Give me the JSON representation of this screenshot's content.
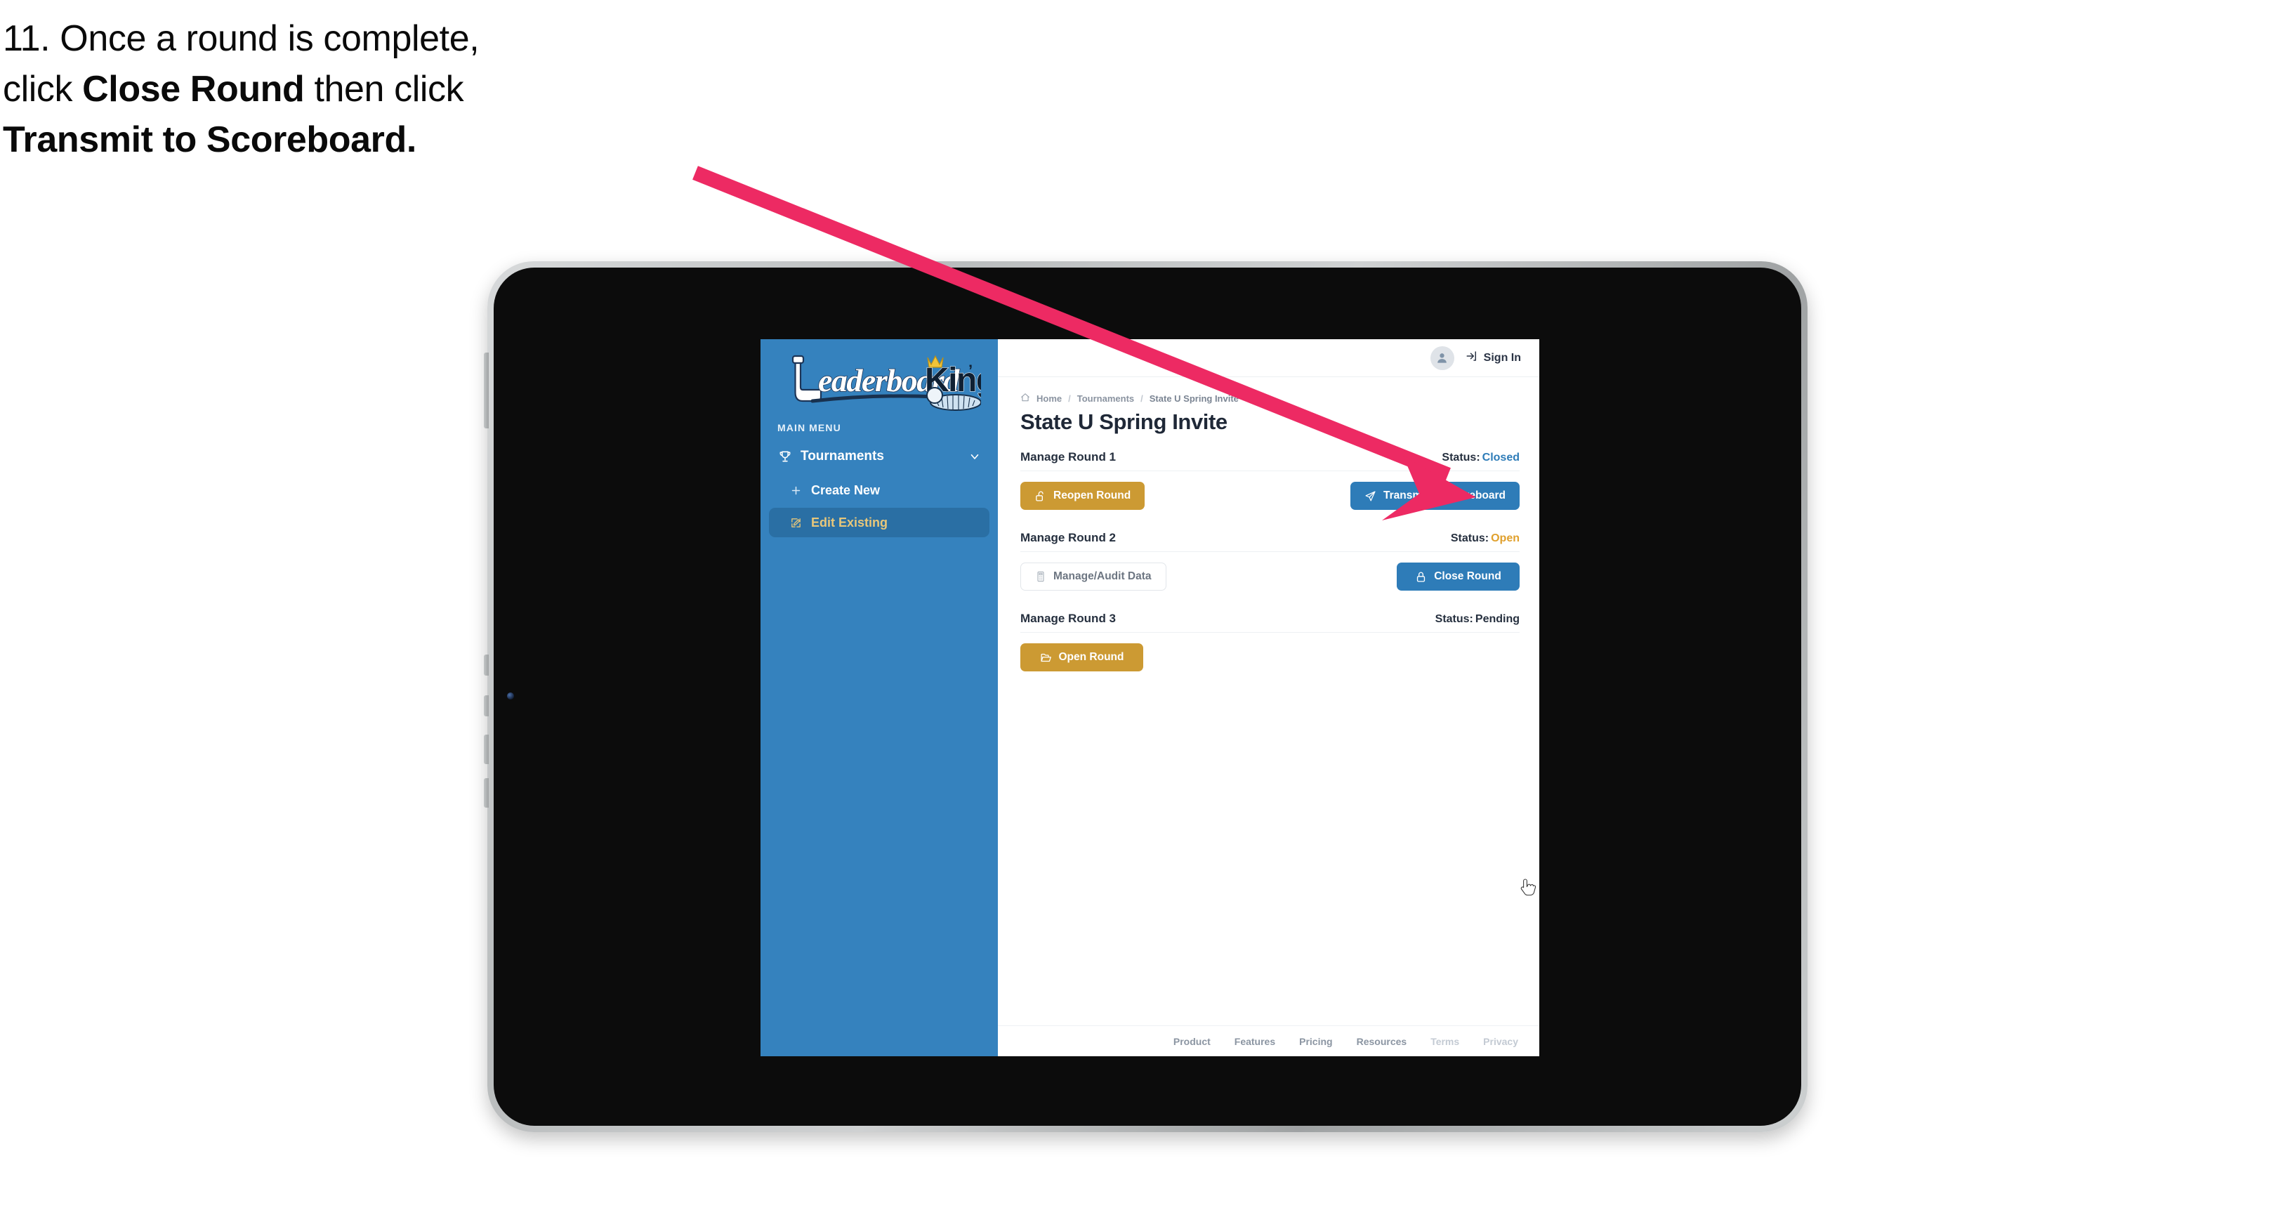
{
  "caption": {
    "line1": "11. Once a round is complete,",
    "line2_pre": "click ",
    "line2_bold": "Close Round",
    "line2_post": " then click",
    "line3_bold": "Transmit to Scoreboard."
  },
  "annotation": {
    "arrow_color": "#ED2A63",
    "arrow_name": "pointer-arrow"
  },
  "sidebar": {
    "logo_primary": "Leaderboard",
    "logo_secondary": "King",
    "menu_label": "MAIN MENU",
    "items": [
      {
        "label": "Tournaments",
        "icon": "trophy-icon",
        "chevron": "chevron-down-icon"
      }
    ],
    "subitems": [
      {
        "label": "Create New",
        "icon": "plus-icon",
        "active": false
      },
      {
        "label": "Edit Existing",
        "icon": "edit-square-icon",
        "active": true
      }
    ],
    "bg_color": "#3582BE",
    "active_bg_color": "#2A6FA4",
    "active_text_color": "#E8C77A"
  },
  "topbar": {
    "avatar_icon": "user-avatar-icon",
    "signin_icon": "sign-in-arrow-icon",
    "signin_label": "Sign In"
  },
  "breadcrumb": {
    "home_icon": "home-icon",
    "items": [
      "Home",
      "Tournaments",
      "State U Spring Invite"
    ],
    "separator": "/"
  },
  "page": {
    "title": "State U Spring Invite"
  },
  "rounds": [
    {
      "title": "Manage Round 1",
      "status_label": "Status:",
      "status_value": "Closed",
      "status_class": "closed",
      "left_button": {
        "label": "Reopen Round",
        "icon": "unlock-icon",
        "style": "gold",
        "width": "btn-w-reopen"
      },
      "right_button": {
        "label": "Transmit to Scoreboard",
        "icon": "paper-plane-icon",
        "style": "blue",
        "width": "btn-w-transmit"
      }
    },
    {
      "title": "Manage Round 2",
      "status_label": "Status:",
      "status_value": "Open",
      "status_class": "open",
      "left_button": {
        "label": "Manage/Audit Data",
        "icon": "calculator-icon",
        "style": "ghost",
        "width": "btn-w-audit"
      },
      "right_button": {
        "label": "Close Round",
        "icon": "lock-icon",
        "style": "blue",
        "width": "btn-w-close"
      }
    },
    {
      "title": "Manage Round 3",
      "status_label": "Status:",
      "status_value": "Pending",
      "status_class": "pending",
      "left_button": {
        "label": "Open Round",
        "icon": "open-folder-icon",
        "style": "gold",
        "width": "btn-w-open"
      },
      "right_button": null
    }
  ],
  "footer": {
    "links": [
      {
        "label": "Product",
        "dim": false
      },
      {
        "label": "Features",
        "dim": false
      },
      {
        "label": "Pricing",
        "dim": false
      },
      {
        "label": "Resources",
        "dim": false
      },
      {
        "label": "Terms",
        "dim": true
      },
      {
        "label": "Privacy",
        "dim": true
      }
    ]
  },
  "cursor": {
    "icon": "pointing-hand-cursor"
  },
  "colors": {
    "gold": "#CC9A33",
    "blue": "#2E7CB8",
    "sidebar_blue": "#3582BE",
    "accent_pink": "#ED2A63",
    "status_open": "#E0A02C",
    "text_dark": "#26303f"
  }
}
